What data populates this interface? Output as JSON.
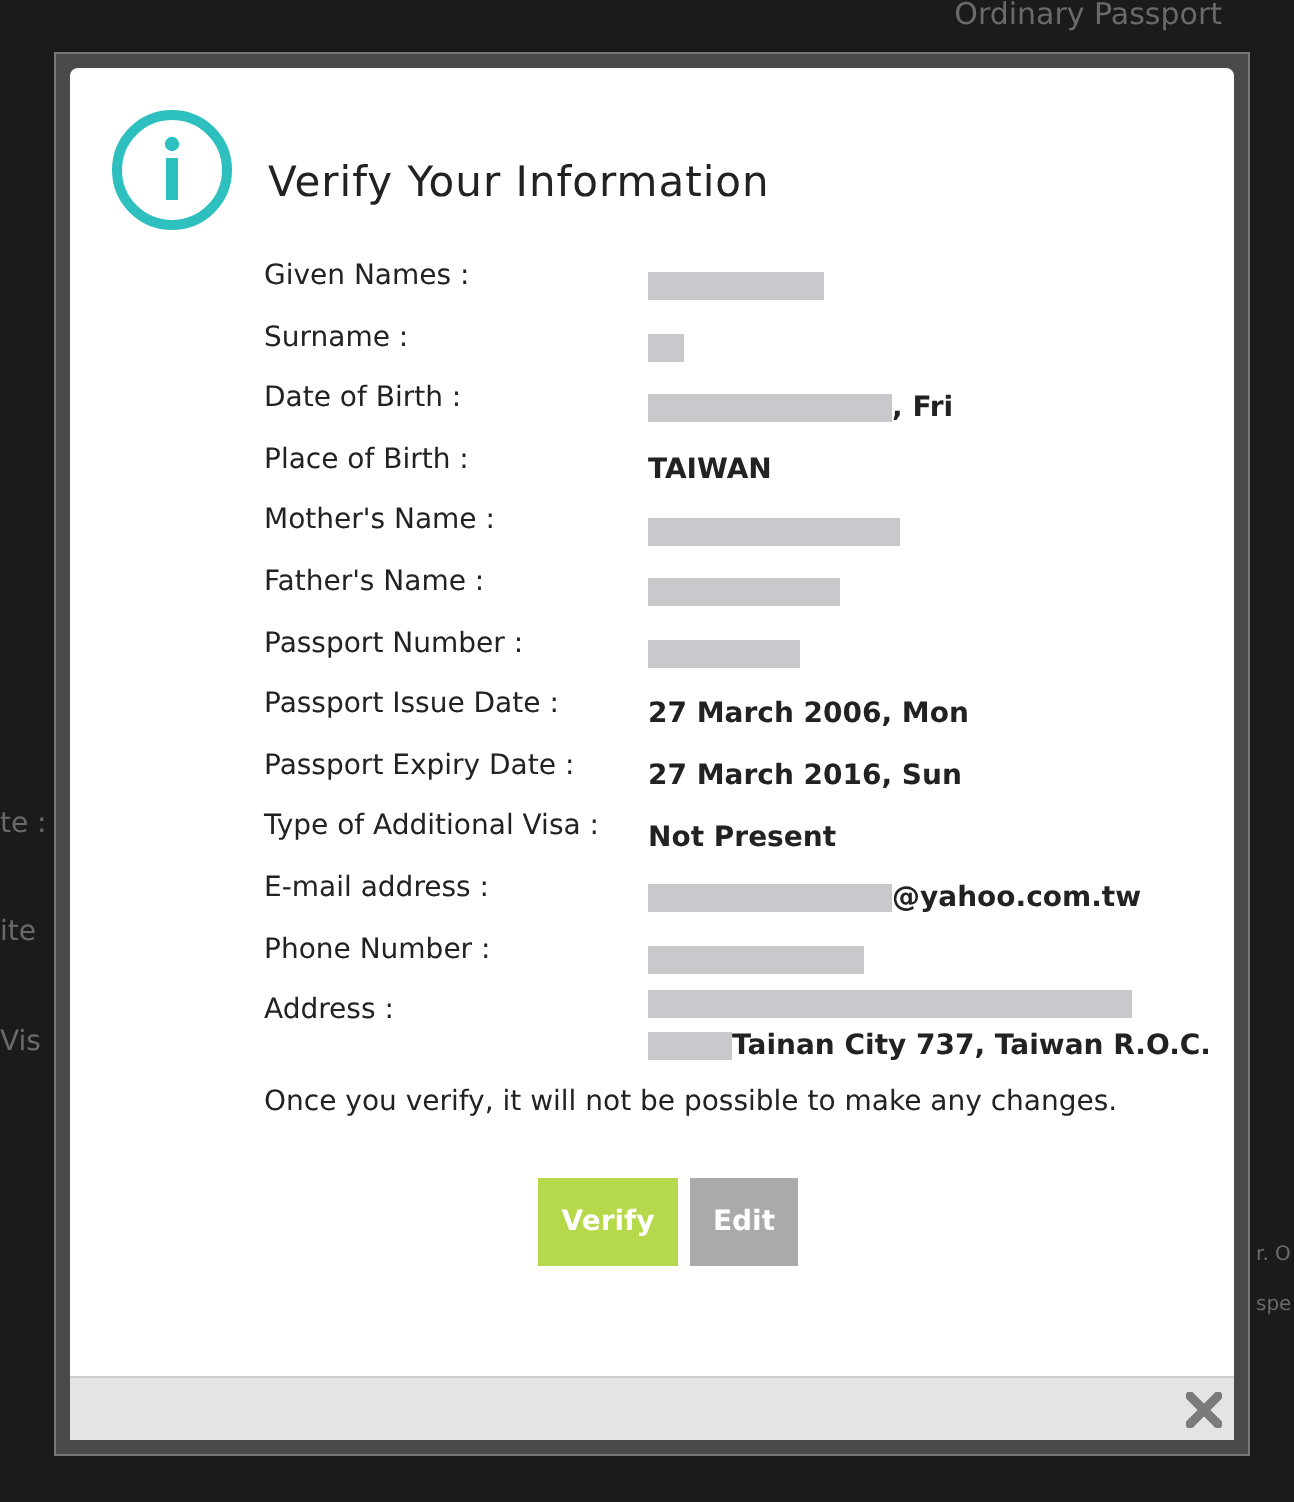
{
  "background": {
    "texts": [
      {
        "text": "Ordinary Passport"
      },
      {
        "text": "te :"
      },
      {
        "text": "ite"
      },
      {
        "text": "Vis"
      },
      {
        "text": "r. O"
      },
      {
        "text": "spe"
      }
    ]
  },
  "dialog": {
    "title": "Verify Your Information",
    "fields": [
      {
        "label": "Given Names :",
        "value": [
          {
            "kind": "redacted"
          }
        ]
      },
      {
        "label": "Surname :",
        "value": [
          {
            "kind": "redacted"
          }
        ]
      },
      {
        "label": "Date of Birth :",
        "value": [
          {
            "kind": "redacted"
          },
          {
            "kind": "text",
            "text": ", Fri"
          }
        ]
      },
      {
        "label": "Place of Birth :",
        "value": [
          {
            "kind": "text",
            "text": "TAIWAN"
          }
        ]
      },
      {
        "label": "Mother's Name :",
        "value": [
          {
            "kind": "redacted"
          }
        ]
      },
      {
        "label": "Father's Name :",
        "value": [
          {
            "kind": "redacted"
          }
        ]
      },
      {
        "label": "Passport Number :",
        "value": [
          {
            "kind": "redacted"
          }
        ]
      },
      {
        "label": "Passport Issue Date :",
        "value": [
          {
            "kind": "text",
            "text": "27 March 2006, Mon"
          }
        ]
      },
      {
        "label": "Passport Expiry Date :",
        "value": [
          {
            "kind": "text",
            "text": "27 March 2016, Sun"
          }
        ]
      },
      {
        "label": "Type of Additional Visa :",
        "value": [
          {
            "kind": "text",
            "text": "Not Present"
          }
        ]
      },
      {
        "label": "E-mail address :",
        "value": [
          {
            "kind": "redacted"
          },
          {
            "kind": "text",
            "text": "@yahoo.com.tw"
          }
        ]
      },
      {
        "label": "Phone Number :",
        "value": [
          {
            "kind": "redacted"
          }
        ]
      },
      {
        "label": "Address :",
        "value": [
          {
            "kind": "redacted"
          },
          {
            "kind": "break"
          },
          {
            "kind": "redacted"
          },
          {
            "kind": "text",
            "text": "Tainan City 737, Taiwan R.O.C."
          }
        ]
      }
    ],
    "notice": "Once you verify, it will not be possible to make any changes.",
    "buttons": [
      {
        "label": "Verify",
        "kind": "primary"
      },
      {
        "label": "Edit",
        "kind": "secondary"
      }
    ]
  }
}
